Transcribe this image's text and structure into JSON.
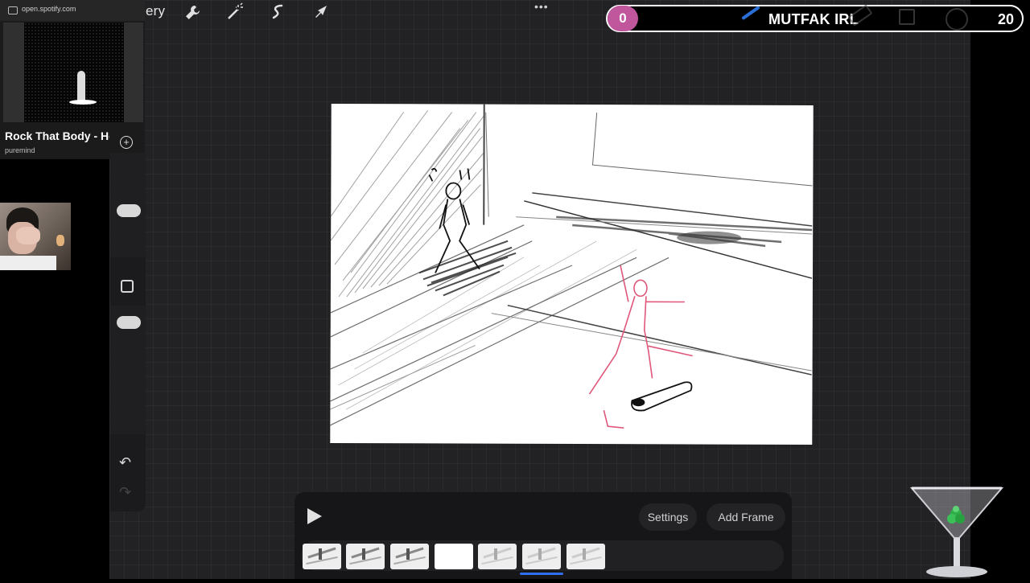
{
  "spotify": {
    "url": "open.spotify.com",
    "song_title": "Rock That Body - He",
    "artist": "puremind",
    "add_icon": "plus-circle-icon"
  },
  "toolbar": {
    "gallery_label": "ery",
    "tools": [
      "wrench-icon",
      "magic-wand-icon",
      "selection-icon",
      "move-arrow-icon"
    ],
    "more_label": "•••"
  },
  "overlay": {
    "count": "0",
    "title": "MUTFAK IRL",
    "number": "20",
    "accent_color": "#c0579c"
  },
  "sidebar": {
    "undo_icon": "undo-icon",
    "redo_icon": "redo-icon"
  },
  "animation": {
    "play_icon": "play-icon",
    "settings_label": "Settings",
    "add_frame_label": "Add Frame",
    "frame_count": 7,
    "active_frame": 6
  },
  "colors": {
    "canvas_bg": "#222225",
    "active_frame_indicator": "#2e6ff0",
    "sketch_pink": "#e0577a"
  }
}
